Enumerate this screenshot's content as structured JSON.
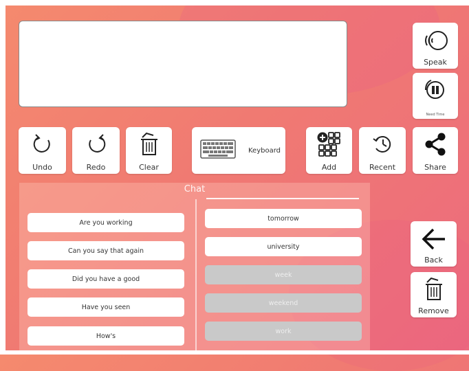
{
  "toolbar": {
    "speak": "Speak",
    "need_time": "Need Time",
    "undo": "Undo",
    "redo": "Redo",
    "clear": "Clear",
    "keyboard": "Keyboard",
    "add": "Add",
    "recent": "Recent",
    "share": "Share"
  },
  "chat": {
    "title": "Chat",
    "phrases": [
      "Are you working",
      "Can you say that again",
      "Did you have a good",
      "Have you seen",
      "How's"
    ],
    "words": [
      {
        "label": "tomorrow",
        "enabled": true
      },
      {
        "label": "university",
        "enabled": true
      },
      {
        "label": "week",
        "enabled": false
      },
      {
        "label": "weekend",
        "enabled": false
      },
      {
        "label": "work",
        "enabled": false
      }
    ]
  },
  "side": {
    "back": "Back",
    "remove": "Remove"
  }
}
